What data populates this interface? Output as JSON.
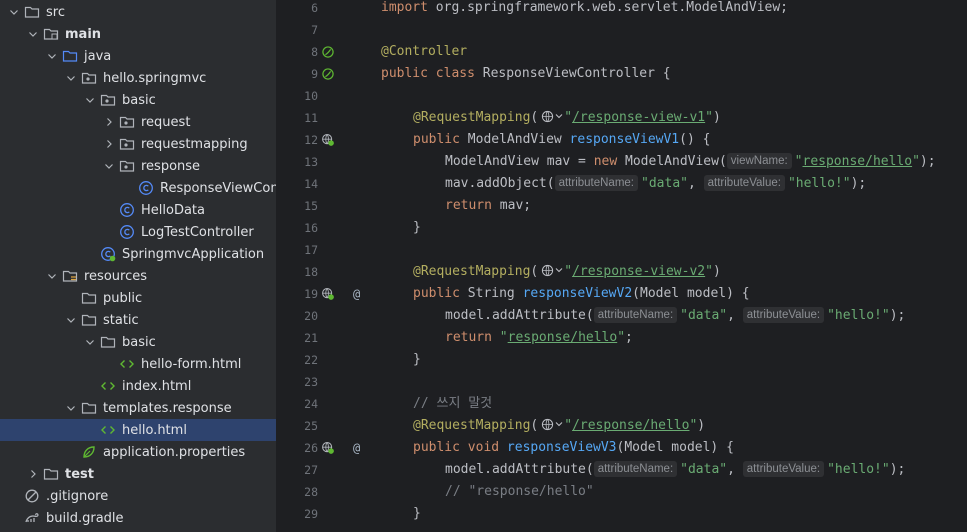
{
  "project_tree": [
    {
      "label": "src",
      "depth": 0,
      "arrow": "down",
      "icon": "folder-icon"
    },
    {
      "label": "main",
      "depth": 1,
      "arrow": "down",
      "icon": "source-folder-icon",
      "bold": true
    },
    {
      "label": "java",
      "depth": 2,
      "arrow": "down",
      "icon": "java-source-folder-icon"
    },
    {
      "label": "hello.springmvc",
      "depth": 3,
      "arrow": "down",
      "icon": "package-icon"
    },
    {
      "label": "basic",
      "depth": 4,
      "arrow": "down",
      "icon": "package-icon"
    },
    {
      "label": "request",
      "depth": 5,
      "arrow": "right",
      "icon": "package-icon"
    },
    {
      "label": "requestmapping",
      "depth": 5,
      "arrow": "right",
      "icon": "package-icon"
    },
    {
      "label": "response",
      "depth": 5,
      "arrow": "down",
      "icon": "package-icon"
    },
    {
      "label": "ResponseViewContr",
      "depth": 6,
      "arrow": "none",
      "icon": "class-icon"
    },
    {
      "label": "HelloData",
      "depth": 5,
      "arrow": "none",
      "icon": "class-icon"
    },
    {
      "label": "LogTestController",
      "depth": 5,
      "arrow": "none",
      "icon": "class-icon"
    },
    {
      "label": "SpringmvcApplication",
      "depth": 4,
      "arrow": "none",
      "icon": "spring-class-icon"
    },
    {
      "label": "resources",
      "depth": 2,
      "arrow": "down",
      "icon": "resources-folder-icon"
    },
    {
      "label": "public",
      "depth": 3,
      "arrow": "none",
      "icon": "folder-icon"
    },
    {
      "label": "static",
      "depth": 3,
      "arrow": "down",
      "icon": "folder-icon"
    },
    {
      "label": "basic",
      "depth": 4,
      "arrow": "down",
      "icon": "folder-icon"
    },
    {
      "label": "hello-form.html",
      "depth": 5,
      "arrow": "none",
      "icon": "html-file-icon"
    },
    {
      "label": "index.html",
      "depth": 4,
      "arrow": "none",
      "icon": "html-file-icon"
    },
    {
      "label": "templates.response",
      "depth": 3,
      "arrow": "down",
      "icon": "folder-icon"
    },
    {
      "label": "hello.html",
      "depth": 4,
      "arrow": "none",
      "icon": "html-file-icon",
      "selected": true
    },
    {
      "label": "application.properties",
      "depth": 3,
      "arrow": "none",
      "icon": "properties-file-icon"
    },
    {
      "label": "test",
      "depth": 1,
      "arrow": "right",
      "icon": "folder-icon",
      "bold": true
    },
    {
      "label": ".gitignore",
      "depth": 0,
      "arrow": "none",
      "icon": "gitignore-file-icon"
    },
    {
      "label": "build.gradle",
      "depth": 0,
      "arrow": "none",
      "icon": "gradle-file-icon"
    }
  ],
  "gutter_icons": [
    {
      "line": "8",
      "icon": "spring-bean-icon",
      "at": false
    },
    {
      "line": "9",
      "icon": "spring-bean-icon",
      "at": false
    },
    {
      "line": "12",
      "icon": "request-mapping-icon",
      "at": false
    },
    {
      "line": "19",
      "icon": "request-mapping-icon",
      "at": true
    },
    {
      "line": "26",
      "icon": "request-mapping-icon",
      "at": true
    }
  ],
  "gutter_at_symbol": "@",
  "code_lines": [
    {
      "n": "6",
      "indent": 0,
      "tokens": [
        {
          "t": "import ",
          "c": "kw"
        },
        {
          "t": "org.springframework.web.servlet.ModelAndView;"
        }
      ]
    },
    {
      "n": "7",
      "indent": 0,
      "tokens": []
    },
    {
      "n": "8",
      "indent": 0,
      "tokens": [
        {
          "t": "@Controller",
          "c": "ann"
        }
      ]
    },
    {
      "n": "9",
      "indent": 0,
      "tokens": [
        {
          "t": "public class ",
          "c": "kw"
        },
        {
          "t": "ResponseViewController {"
        }
      ]
    },
    {
      "n": "10",
      "indent": 0,
      "tokens": []
    },
    {
      "n": "11",
      "indent": 1,
      "tokens": [
        {
          "t": "@RequestMapping",
          "c": "ann"
        },
        {
          "t": "("
        },
        {
          "globe": true
        },
        {
          "t": "\"",
          "c": "str"
        },
        {
          "t": "/response-view-v1",
          "c": "url"
        },
        {
          "t": "\"",
          "c": "str"
        },
        {
          "t": ")"
        }
      ]
    },
    {
      "n": "12",
      "indent": 1,
      "tokens": [
        {
          "t": "public ",
          "c": "kw"
        },
        {
          "t": "ModelAndView "
        },
        {
          "t": "responseViewV1",
          "c": "fn"
        },
        {
          "t": "() {"
        }
      ]
    },
    {
      "n": "13",
      "indent": 2,
      "tokens": [
        {
          "t": "ModelAndView mav = "
        },
        {
          "t": "new ",
          "c": "kw"
        },
        {
          "t": "ModelAndView("
        },
        {
          "hint": "viewName:"
        },
        {
          "t": "\"",
          "c": "str"
        },
        {
          "t": "response/hello",
          "c": "url"
        },
        {
          "t": "\"",
          "c": "str"
        },
        {
          "t": ");"
        }
      ]
    },
    {
      "n": "14",
      "indent": 2,
      "tokens": [
        {
          "t": "mav.addObject("
        },
        {
          "hint": "attributeName:"
        },
        {
          "t": "\"data\"",
          "c": "str"
        },
        {
          "t": ", "
        },
        {
          "hint": "attributeValue:"
        },
        {
          "t": "\"hello!\"",
          "c": "str"
        },
        {
          "t": ");"
        }
      ]
    },
    {
      "n": "15",
      "indent": 2,
      "tokens": [
        {
          "t": "return ",
          "c": "kw"
        },
        {
          "t": "mav;"
        }
      ]
    },
    {
      "n": "16",
      "indent": 1,
      "tokens": [
        {
          "t": "}"
        }
      ]
    },
    {
      "n": "17",
      "indent": 0,
      "tokens": []
    },
    {
      "n": "18",
      "indent": 1,
      "tokens": [
        {
          "t": "@RequestMapping",
          "c": "ann"
        },
        {
          "t": "("
        },
        {
          "globe": true
        },
        {
          "t": "\"",
          "c": "str"
        },
        {
          "t": "/response-view-v2",
          "c": "url"
        },
        {
          "t": "\"",
          "c": "str"
        },
        {
          "t": ")"
        }
      ]
    },
    {
      "n": "19",
      "indent": 1,
      "tokens": [
        {
          "t": "public ",
          "c": "kw"
        },
        {
          "t": "String "
        },
        {
          "t": "responseViewV2",
          "c": "fn"
        },
        {
          "t": "(Model model) {"
        }
      ]
    },
    {
      "n": "20",
      "indent": 2,
      "tokens": [
        {
          "t": "model.addAttribute("
        },
        {
          "hint": "attributeName:"
        },
        {
          "t": "\"data\"",
          "c": "str"
        },
        {
          "t": ", "
        },
        {
          "hint": "attributeValue:"
        },
        {
          "t": "\"hello!\"",
          "c": "str"
        },
        {
          "t": ");"
        }
      ]
    },
    {
      "n": "21",
      "indent": 2,
      "tokens": [
        {
          "t": "return ",
          "c": "kw"
        },
        {
          "t": "\"",
          "c": "str"
        },
        {
          "t": "response/hello",
          "c": "url"
        },
        {
          "t": "\"",
          "c": "str"
        },
        {
          "t": ";"
        }
      ]
    },
    {
      "n": "22",
      "indent": 1,
      "tokens": [
        {
          "t": "}"
        }
      ]
    },
    {
      "n": "23",
      "indent": 0,
      "tokens": []
    },
    {
      "n": "24",
      "indent": 1,
      "tokens": [
        {
          "t": "// 쓰지 말것",
          "c": "cm"
        }
      ]
    },
    {
      "n": "25",
      "indent": 1,
      "tokens": [
        {
          "t": "@RequestMapping",
          "c": "ann"
        },
        {
          "t": "("
        },
        {
          "globe": true
        },
        {
          "t": "\"",
          "c": "str"
        },
        {
          "t": "/response/hello",
          "c": "url"
        },
        {
          "t": "\"",
          "c": "str"
        },
        {
          "t": ")"
        }
      ]
    },
    {
      "n": "26",
      "indent": 1,
      "tokens": [
        {
          "t": "public void ",
          "c": "kw"
        },
        {
          "t": "responseViewV3",
          "c": "fn"
        },
        {
          "t": "(Model model) {"
        }
      ]
    },
    {
      "n": "27",
      "indent": 2,
      "tokens": [
        {
          "t": "model.addAttribute("
        },
        {
          "hint": "attributeName:"
        },
        {
          "t": "\"data\"",
          "c": "str"
        },
        {
          "t": ", "
        },
        {
          "hint": "attributeValue:"
        },
        {
          "t": "\"hello!\"",
          "c": "str"
        },
        {
          "t": ");"
        }
      ]
    },
    {
      "n": "28",
      "indent": 2,
      "tokens": [
        {
          "t": "// \"response/hello\"",
          "c": "cm"
        }
      ]
    },
    {
      "n": "29",
      "indent": 1,
      "tokens": [
        {
          "t": "}"
        }
      ]
    }
  ]
}
